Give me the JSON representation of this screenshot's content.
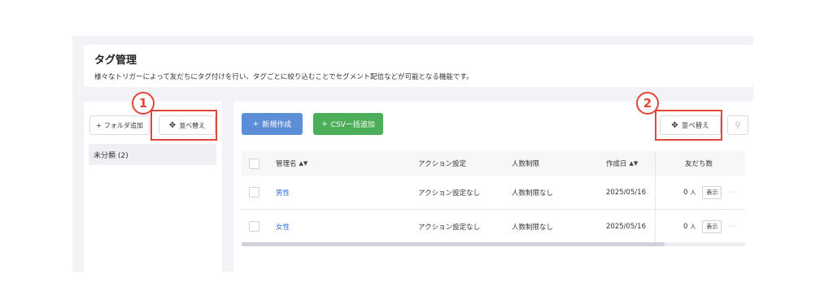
{
  "header": {
    "title": "タグ管理",
    "description": "様々なトリガーによって友だちにタグ付けを行い、タグごとに絞り込むことでセグメント配信などが可能となる機能です。"
  },
  "sidebar": {
    "add_folder_label": "フォルダ追加",
    "sort_label": "並べ替え",
    "uncategorized_label": "未分類 (2)"
  },
  "toolbar": {
    "new_label": "新規作成",
    "csv_label": "CSV一括追加",
    "sort_label": "並べ替え",
    "plus": "+"
  },
  "table": {
    "columns": {
      "name": "管理名",
      "action": "アクション設定",
      "limit": "人数制限",
      "created": "作成日",
      "friends": "友だち数"
    },
    "rows": [
      {
        "name": "男性",
        "action": "アクション設定なし",
        "limit": "人数制限なし",
        "created": "2025/05/16",
        "count": "0",
        "unit": "人",
        "show": "表示"
      },
      {
        "name": "女性",
        "action": "アクション設定なし",
        "limit": "人数制限なし",
        "created": "2025/05/16",
        "count": "0",
        "unit": "人",
        "show": "表示"
      }
    ]
  },
  "callouts": {
    "one": "1",
    "two": "2"
  },
  "colors": {
    "accent_red": "#e0463a",
    "primary_blue": "#5b8ed6",
    "success_green": "#4cae58",
    "link_blue": "#2f6fd0"
  }
}
